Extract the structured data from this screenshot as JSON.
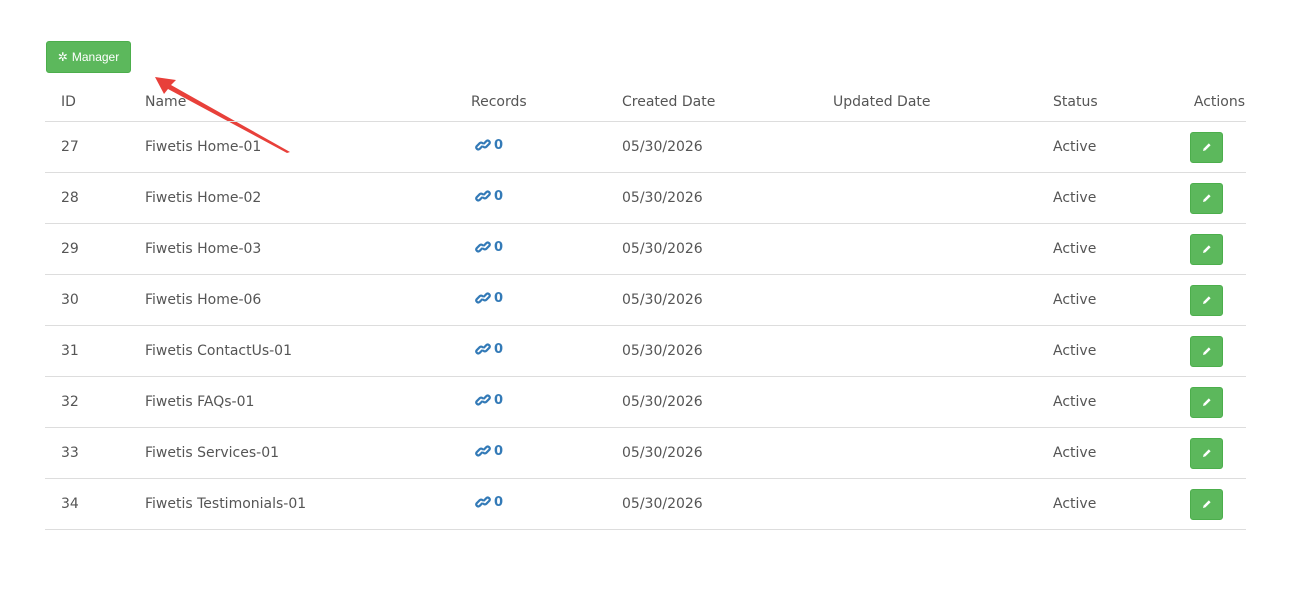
{
  "toolbar": {
    "manager_label": "Manager",
    "manager_icon": "gear-icon"
  },
  "annotation": {
    "arrow_color": "#e8403a"
  },
  "colors": {
    "button_green": "#5cb85c",
    "link_blue": "#337ab7"
  },
  "table": {
    "headers": {
      "id": "ID",
      "name": "Name",
      "records": "Records",
      "created": "Created Date",
      "updated": "Updated Date",
      "status": "Status",
      "actions": "Actions"
    },
    "rows": [
      {
        "id": "27",
        "name": "Fiwetis Home-01",
        "records": "0",
        "created": "05/30/2026",
        "updated": "",
        "status": "Active"
      },
      {
        "id": "28",
        "name": "Fiwetis Home-02",
        "records": "0",
        "created": "05/30/2026",
        "updated": "",
        "status": "Active"
      },
      {
        "id": "29",
        "name": "Fiwetis Home-03",
        "records": "0",
        "created": "05/30/2026",
        "updated": "",
        "status": "Active"
      },
      {
        "id": "30",
        "name": "Fiwetis Home-06",
        "records": "0",
        "created": "05/30/2026",
        "updated": "",
        "status": "Active"
      },
      {
        "id": "31",
        "name": "Fiwetis ContactUs-01",
        "records": "0",
        "created": "05/30/2026",
        "updated": "",
        "status": "Active"
      },
      {
        "id": "32",
        "name": "Fiwetis FAQs-01",
        "records": "0",
        "created": "05/30/2026",
        "updated": "",
        "status": "Active"
      },
      {
        "id": "33",
        "name": "Fiwetis Services-01",
        "records": "0",
        "created": "05/30/2026",
        "updated": "",
        "status": "Active"
      },
      {
        "id": "34",
        "name": "Fiwetis Testimonials-01",
        "records": "0",
        "created": "05/30/2026",
        "updated": "",
        "status": "Active"
      }
    ]
  }
}
